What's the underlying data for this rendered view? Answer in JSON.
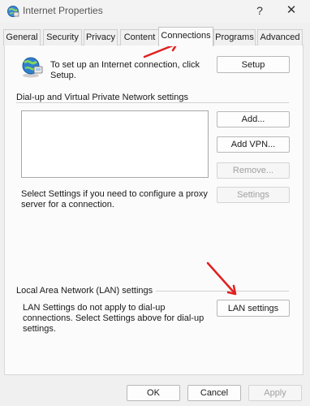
{
  "window": {
    "title": "Internet Properties",
    "help": "?",
    "close": "✕"
  },
  "tabs": [
    {
      "label": "General"
    },
    {
      "label": "Security"
    },
    {
      "label": "Privacy"
    },
    {
      "label": "Content"
    },
    {
      "label": "Connections",
      "active": true
    },
    {
      "label": "Programs"
    },
    {
      "label": "Advanced"
    }
  ],
  "setup": {
    "text": "To set up an Internet connection, click Setup.",
    "button": "Setup"
  },
  "dialup": {
    "heading": "Dial-up and Virtual Private Network settings",
    "add": "Add...",
    "add_vpn": "Add VPN...",
    "remove": "Remove...",
    "settings": "Settings",
    "proxy_text": "Select Settings if you need to configure a proxy server for a connection."
  },
  "lan": {
    "heading": "Local Area Network (LAN) settings",
    "text": "LAN Settings do not apply to dial-up connections. Select Settings above for dial-up settings.",
    "button": "LAN settings"
  },
  "footer": {
    "ok": "OK",
    "cancel": "Cancel",
    "apply": "Apply"
  },
  "colors": {
    "arrow": "#e02020",
    "panel_bg": "#fbfbfb",
    "window_bg": "#f0f0f0"
  }
}
